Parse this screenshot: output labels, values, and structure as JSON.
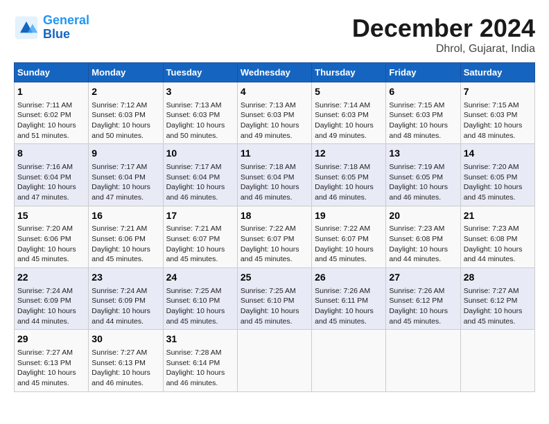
{
  "logo": {
    "line1": "General",
    "line2": "Blue"
  },
  "title": "December 2024",
  "subtitle": "Dhrol, Gujarat, India",
  "days_of_week": [
    "Sunday",
    "Monday",
    "Tuesday",
    "Wednesday",
    "Thursday",
    "Friday",
    "Saturday"
  ],
  "weeks": [
    [
      {
        "day": "1",
        "info": "Sunrise: 7:11 AM\nSunset: 6:02 PM\nDaylight: 10 hours\nand 51 minutes."
      },
      {
        "day": "2",
        "info": "Sunrise: 7:12 AM\nSunset: 6:03 PM\nDaylight: 10 hours\nand 50 minutes."
      },
      {
        "day": "3",
        "info": "Sunrise: 7:13 AM\nSunset: 6:03 PM\nDaylight: 10 hours\nand 50 minutes."
      },
      {
        "day": "4",
        "info": "Sunrise: 7:13 AM\nSunset: 6:03 PM\nDaylight: 10 hours\nand 49 minutes."
      },
      {
        "day": "5",
        "info": "Sunrise: 7:14 AM\nSunset: 6:03 PM\nDaylight: 10 hours\nand 49 minutes."
      },
      {
        "day": "6",
        "info": "Sunrise: 7:15 AM\nSunset: 6:03 PM\nDaylight: 10 hours\nand 48 minutes."
      },
      {
        "day": "7",
        "info": "Sunrise: 7:15 AM\nSunset: 6:03 PM\nDaylight: 10 hours\nand 48 minutes."
      }
    ],
    [
      {
        "day": "8",
        "info": "Sunrise: 7:16 AM\nSunset: 6:04 PM\nDaylight: 10 hours\nand 47 minutes."
      },
      {
        "day": "9",
        "info": "Sunrise: 7:17 AM\nSunset: 6:04 PM\nDaylight: 10 hours\nand 47 minutes."
      },
      {
        "day": "10",
        "info": "Sunrise: 7:17 AM\nSunset: 6:04 PM\nDaylight: 10 hours\nand 46 minutes."
      },
      {
        "day": "11",
        "info": "Sunrise: 7:18 AM\nSunset: 6:04 PM\nDaylight: 10 hours\nand 46 minutes."
      },
      {
        "day": "12",
        "info": "Sunrise: 7:18 AM\nSunset: 6:05 PM\nDaylight: 10 hours\nand 46 minutes."
      },
      {
        "day": "13",
        "info": "Sunrise: 7:19 AM\nSunset: 6:05 PM\nDaylight: 10 hours\nand 46 minutes."
      },
      {
        "day": "14",
        "info": "Sunrise: 7:20 AM\nSunset: 6:05 PM\nDaylight: 10 hours\nand 45 minutes."
      }
    ],
    [
      {
        "day": "15",
        "info": "Sunrise: 7:20 AM\nSunset: 6:06 PM\nDaylight: 10 hours\nand 45 minutes."
      },
      {
        "day": "16",
        "info": "Sunrise: 7:21 AM\nSunset: 6:06 PM\nDaylight: 10 hours\nand 45 minutes."
      },
      {
        "day": "17",
        "info": "Sunrise: 7:21 AM\nSunset: 6:07 PM\nDaylight: 10 hours\nand 45 minutes."
      },
      {
        "day": "18",
        "info": "Sunrise: 7:22 AM\nSunset: 6:07 PM\nDaylight: 10 hours\nand 45 minutes."
      },
      {
        "day": "19",
        "info": "Sunrise: 7:22 AM\nSunset: 6:07 PM\nDaylight: 10 hours\nand 45 minutes."
      },
      {
        "day": "20",
        "info": "Sunrise: 7:23 AM\nSunset: 6:08 PM\nDaylight: 10 hours\nand 44 minutes."
      },
      {
        "day": "21",
        "info": "Sunrise: 7:23 AM\nSunset: 6:08 PM\nDaylight: 10 hours\nand 44 minutes."
      }
    ],
    [
      {
        "day": "22",
        "info": "Sunrise: 7:24 AM\nSunset: 6:09 PM\nDaylight: 10 hours\nand 44 minutes."
      },
      {
        "day": "23",
        "info": "Sunrise: 7:24 AM\nSunset: 6:09 PM\nDaylight: 10 hours\nand 44 minutes."
      },
      {
        "day": "24",
        "info": "Sunrise: 7:25 AM\nSunset: 6:10 PM\nDaylight: 10 hours\nand 45 minutes."
      },
      {
        "day": "25",
        "info": "Sunrise: 7:25 AM\nSunset: 6:10 PM\nDaylight: 10 hours\nand 45 minutes."
      },
      {
        "day": "26",
        "info": "Sunrise: 7:26 AM\nSunset: 6:11 PM\nDaylight: 10 hours\nand 45 minutes."
      },
      {
        "day": "27",
        "info": "Sunrise: 7:26 AM\nSunset: 6:12 PM\nDaylight: 10 hours\nand 45 minutes."
      },
      {
        "day": "28",
        "info": "Sunrise: 7:27 AM\nSunset: 6:12 PM\nDaylight: 10 hours\nand 45 minutes."
      }
    ],
    [
      {
        "day": "29",
        "info": "Sunrise: 7:27 AM\nSunset: 6:13 PM\nDaylight: 10 hours\nand 45 minutes."
      },
      {
        "day": "30",
        "info": "Sunrise: 7:27 AM\nSunset: 6:13 PM\nDaylight: 10 hours\nand 46 minutes."
      },
      {
        "day": "31",
        "info": "Sunrise: 7:28 AM\nSunset: 6:14 PM\nDaylight: 10 hours\nand 46 minutes."
      },
      {
        "day": "",
        "info": ""
      },
      {
        "day": "",
        "info": ""
      },
      {
        "day": "",
        "info": ""
      },
      {
        "day": "",
        "info": ""
      }
    ]
  ]
}
